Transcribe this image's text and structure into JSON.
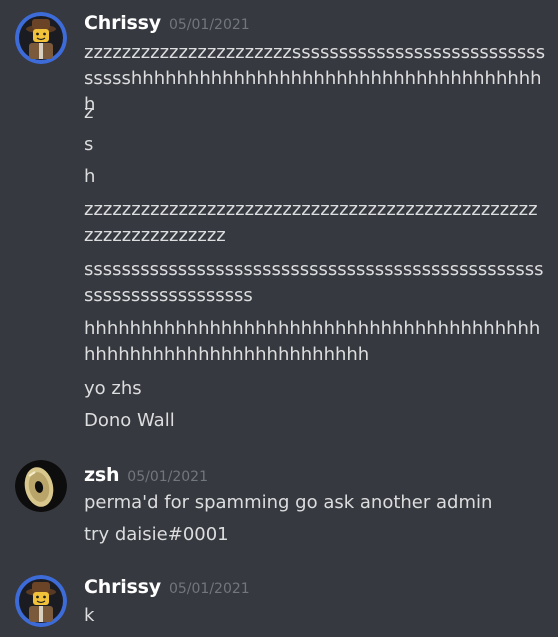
{
  "messages": [
    {
      "author": "Chrissy",
      "timestamp": "05/01/2021",
      "avatar": "lego-minifig-avatar",
      "lines": [
        "zzzzzzzzzzzzzzzzzzzzzzsssssssssssssssssssssssssssssssshhhhhhhhhhhhhhhhhhhhhhhhhhhhhhhhhhhhh",
        "z",
        "s",
        "h",
        "zzzzzzzzzzzzzzzzzzzzzzzzzzzzzzzzzzzzzzzzzzzzzzzzzzzzzzzzzzzzzzz",
        "sssssssssssssssssssssssssssssssssssssssssssssssssssssssssssssssssss",
        "hhhhhhhhhhhhhhhhhhhhhhhhhhhhhhhhhhhhhhhhhhhhhhhhhhhhhhhhhhhhhhhhh",
        "yo zhs",
        "Dono Wall"
      ]
    },
    {
      "author": "zsh",
      "timestamp": "05/01/2021",
      "avatar": "disc-avatar",
      "lines": [
        "perma'd for spamming go ask another admin",
        "try daisie#0001"
      ]
    },
    {
      "author": "Chrissy",
      "timestamp": "05/01/2021",
      "avatar": "lego-minifig-avatar",
      "lines": [
        "k"
      ]
    }
  ],
  "colors": {
    "background": "#36393f",
    "username": "#ffffff",
    "timestamp": "#72767d",
    "text": "#dcddde",
    "avatar_ring": "#3d6bd8"
  }
}
